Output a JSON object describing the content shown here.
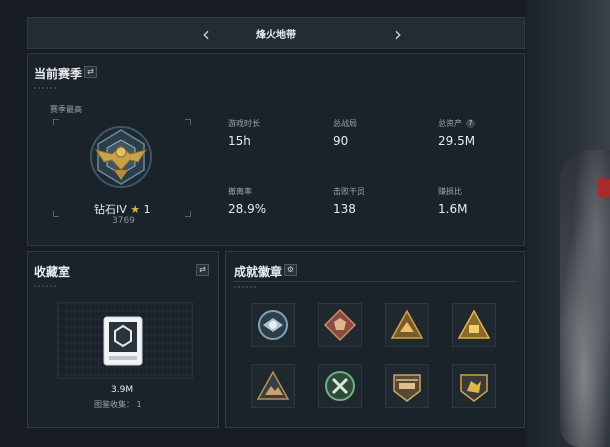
{
  "header": {
    "title": "烽火地带",
    "prev_icon": "chevron-left-icon",
    "next_icon": "chevron-right-icon"
  },
  "season": {
    "title": "当前赛季",
    "switch_icon": "swap-icon",
    "best_label": "赛季最高",
    "rank": {
      "name": "钻石IV",
      "star_count": "1",
      "score": "3769"
    },
    "stats": [
      {
        "label": "游戏时长",
        "value": "15h"
      },
      {
        "label": "总战局",
        "value": "90"
      },
      {
        "label": "总资产",
        "value": "29.5M",
        "help": "?"
      },
      {
        "label": "撤离率",
        "value": "28.9%"
      },
      {
        "label": "击败干员",
        "value": "138"
      },
      {
        "label": "赚损比",
        "value": "1.6M"
      }
    ]
  },
  "collection": {
    "title": "收藏室",
    "switch_icon": "swap-icon",
    "value": "3.9M",
    "count_label": "图鉴收集：",
    "count": "1"
  },
  "achievements": {
    "title": "成就徽章",
    "settings_icon": "gear-icon",
    "badges": [
      "shield-wings-badge-icon",
      "dragon-emblem-badge-icon",
      "hunter-triangle-badge-icon",
      "cargo-triangle-badge-icon",
      "mountain-triangle-badge-icon",
      "green-cross-badge-icon",
      "helicopter-badge-icon",
      "beast-shield-badge-icon"
    ]
  },
  "colors": {
    "panel": "#1b232a",
    "border": "#2f3a44",
    "gold": "#d8b24a",
    "text": "#e8ecef",
    "muted": "#9aa4ac"
  }
}
